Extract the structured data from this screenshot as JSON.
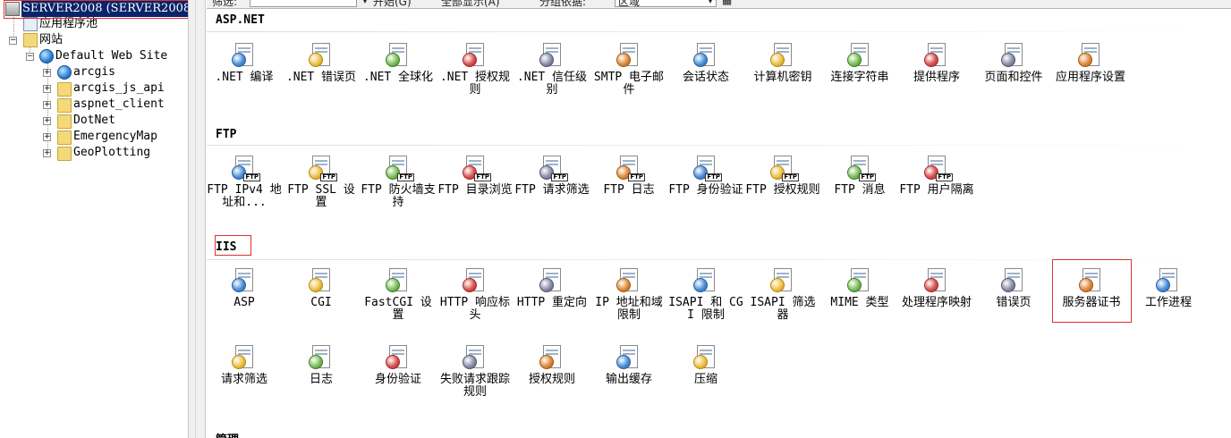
{
  "tree": {
    "server": "SERVER2008 (SERVER2008\\",
    "app_pools": "应用程序池",
    "sites": "网站",
    "default_site": "Default Web Site",
    "children": [
      "arcgis",
      "arcgis_js_api",
      "aspnet_client",
      "DotNet",
      "EmergencyMap",
      "GeoPlotting"
    ]
  },
  "toolbar": {
    "filter_label": "筛选:",
    "start_label": "开始(G)",
    "show_all_label": "全部显示(A)",
    "group_by_label": "分组依据:",
    "group_by_value": "区域"
  },
  "groups": {
    "aspnet": {
      "title": "ASP.NET",
      "items": [
        {
          "label": ".NET 编译",
          "icon": "dotnet-compile-icon"
        },
        {
          "label": ".NET 错误页",
          "icon": "dotnet-error-pages-icon"
        },
        {
          "label": ".NET 全球化",
          "icon": "dotnet-globalization-icon"
        },
        {
          "label": ".NET 授权规则",
          "icon": "dotnet-authorization-icon"
        },
        {
          "label": ".NET 信任级别",
          "icon": "dotnet-trust-levels-icon"
        },
        {
          "label": "SMTP 电子邮件",
          "icon": "smtp-email-icon"
        },
        {
          "label": "会话状态",
          "icon": "session-state-icon"
        },
        {
          "label": "计算机密钥",
          "icon": "machine-key-icon"
        },
        {
          "label": "连接字符串",
          "icon": "connection-strings-icon"
        },
        {
          "label": "提供程序",
          "icon": "providers-icon"
        },
        {
          "label": "页面和控件",
          "icon": "pages-controls-icon"
        },
        {
          "label": "应用程序设置",
          "icon": "app-settings-icon"
        }
      ]
    },
    "ftp": {
      "title": "FTP",
      "items": [
        {
          "label": "FTP IPv4 地址和...",
          "icon": "ftp-ipv4-icon"
        },
        {
          "label": "FTP SSL 设置",
          "icon": "ftp-ssl-icon"
        },
        {
          "label": "FTP 防火墙支持",
          "icon": "ftp-firewall-icon"
        },
        {
          "label": "FTP 目录浏览",
          "icon": "ftp-directory-browsing-icon"
        },
        {
          "label": "FTP 请求筛选",
          "icon": "ftp-request-filtering-icon"
        },
        {
          "label": "FTP 日志",
          "icon": "ftp-logging-icon"
        },
        {
          "label": "FTP 身份验证",
          "icon": "ftp-authentication-icon"
        },
        {
          "label": "FTP 授权规则",
          "icon": "ftp-authorization-icon"
        },
        {
          "label": "FTP 消息",
          "icon": "ftp-messages-icon"
        },
        {
          "label": "FTP 用户隔离",
          "icon": "ftp-user-isolation-icon"
        }
      ]
    },
    "iis": {
      "title": "IIS",
      "items": [
        {
          "label": "ASP",
          "icon": "asp-icon"
        },
        {
          "label": "CGI",
          "icon": "cgi-icon"
        },
        {
          "label": "FastCGI 设置",
          "icon": "fastcgi-icon"
        },
        {
          "label": "HTTP 响应标头",
          "icon": "http-response-headers-icon"
        },
        {
          "label": "HTTP 重定向",
          "icon": "http-redirect-icon"
        },
        {
          "label": "IP 地址和域限制",
          "icon": "ip-domain-restrictions-icon"
        },
        {
          "label": "ISAPI 和 CGI 限制",
          "icon": "isapi-cgi-restrictions-icon"
        },
        {
          "label": "ISAPI 筛选器",
          "icon": "isapi-filters-icon"
        },
        {
          "label": "MIME 类型",
          "icon": "mime-types-icon"
        },
        {
          "label": "处理程序映射",
          "icon": "handler-mappings-icon"
        },
        {
          "label": "错误页",
          "icon": "error-pages-icon"
        },
        {
          "label": "服务器证书",
          "icon": "server-certificates-icon"
        },
        {
          "label": "工作进程",
          "icon": "worker-processes-icon"
        },
        {
          "label": "请求筛选",
          "icon": "request-filtering-icon"
        },
        {
          "label": "日志",
          "icon": "logging-icon"
        },
        {
          "label": "身份验证",
          "icon": "authentication-icon"
        },
        {
          "label": "失败请求跟踪规则",
          "icon": "failed-request-tracing-icon"
        },
        {
          "label": "授权规则",
          "icon": "authorization-rules-icon"
        },
        {
          "label": "输出缓存",
          "icon": "output-caching-icon"
        },
        {
          "label": "压缩",
          "icon": "compression-icon"
        }
      ]
    },
    "management": {
      "title": "管理"
    }
  },
  "colors": {
    "selection": "#0a246a",
    "highlight_frame": "#e03030",
    "panel_bg": "#f0f0f0"
  }
}
